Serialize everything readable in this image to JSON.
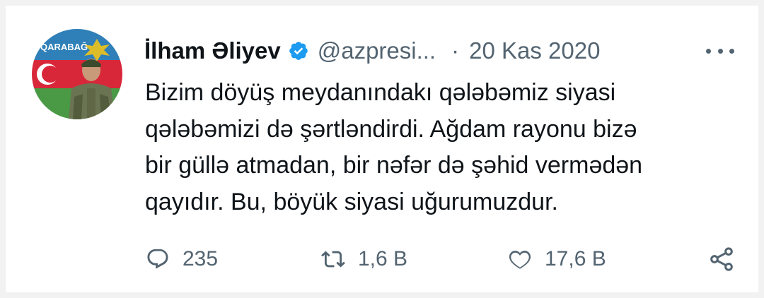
{
  "tweet": {
    "display_name": "İlham Əliyev",
    "handle": "@azpresi...",
    "separator": "·",
    "date": "20 Kas 2020",
    "text_lines": [
      "Bizim döyüş meydanındakı qələbəmiz siyasi",
      "qələbəmizi də şərtləndirdi. Ağdam rayonu bizə",
      "bir güllə atmadan, bir nəfər də şəhid vermədən",
      "qayıdır. Bu, böyük siyasi uğurumuzdur."
    ],
    "avatar_badge_text": "QARABAĞ"
  },
  "actions": {
    "reply_count": "235",
    "retweet_count": "1,6 B",
    "like_count": "17,6 B"
  },
  "icons": {
    "verified": "verified-badge-icon",
    "more": "more-dots-icon",
    "reply": "reply-bubble-icon",
    "retweet": "retweet-icon",
    "like": "heart-icon",
    "share": "share-icon"
  },
  "colors": {
    "verified_blue": "#1d9bf0",
    "text_primary": "#0f1419",
    "text_secondary": "#536471"
  }
}
